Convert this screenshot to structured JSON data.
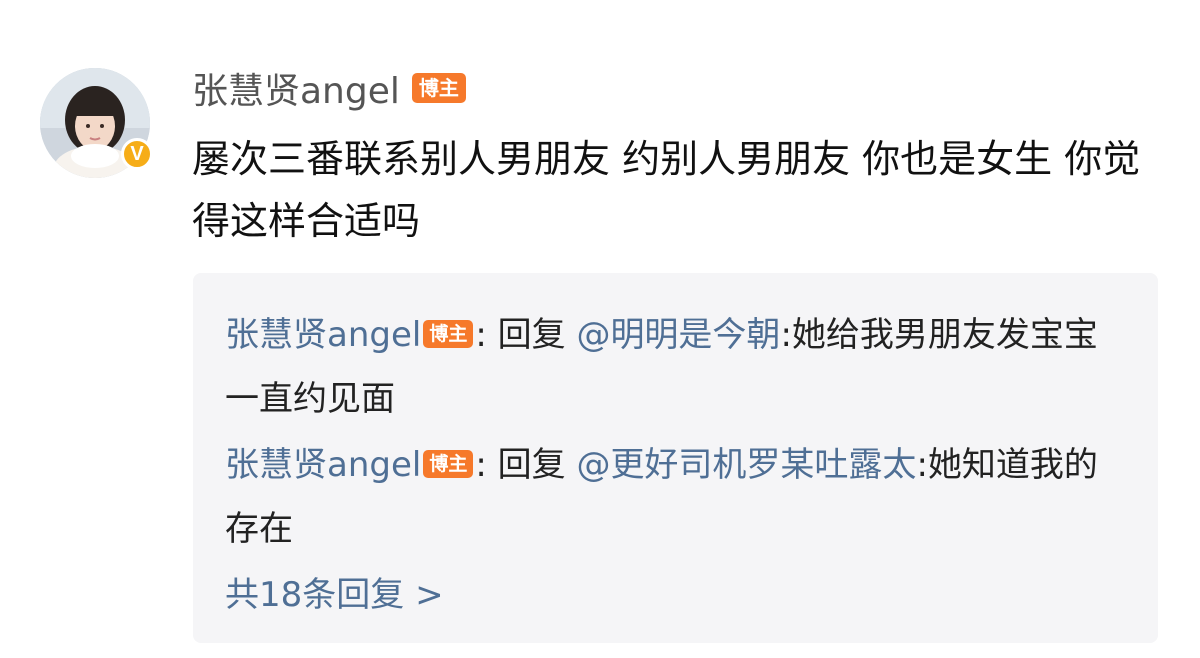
{
  "comment": {
    "author": "张慧贤angel",
    "author_badge": "博主",
    "verified_mark": "V",
    "text": "屡次三番联系别人男朋友 约别人男朋友 你也是女生 你觉得这样合适吗",
    "avatar_icon": "avatar-photo"
  },
  "replies": [
    {
      "author": "张慧贤angel",
      "badge": "博主",
      "reply_word": ": 回复 ",
      "mention": "@明明是今朝",
      "text": ":她给我男朋友发宝宝 一直约见面"
    },
    {
      "author": "张慧贤angel",
      "badge": "博主",
      "reply_word": ": 回复 ",
      "mention": "@更好司机罗某吐露太",
      "text": ":她知道我的存在"
    }
  ],
  "more_replies": "共18条回复 >",
  "colors": {
    "badge_orange": "#f6792b",
    "verify_yellow": "#f6ad18",
    "link_blue": "#4f6f95",
    "reply_bg": "#f5f5f7"
  }
}
